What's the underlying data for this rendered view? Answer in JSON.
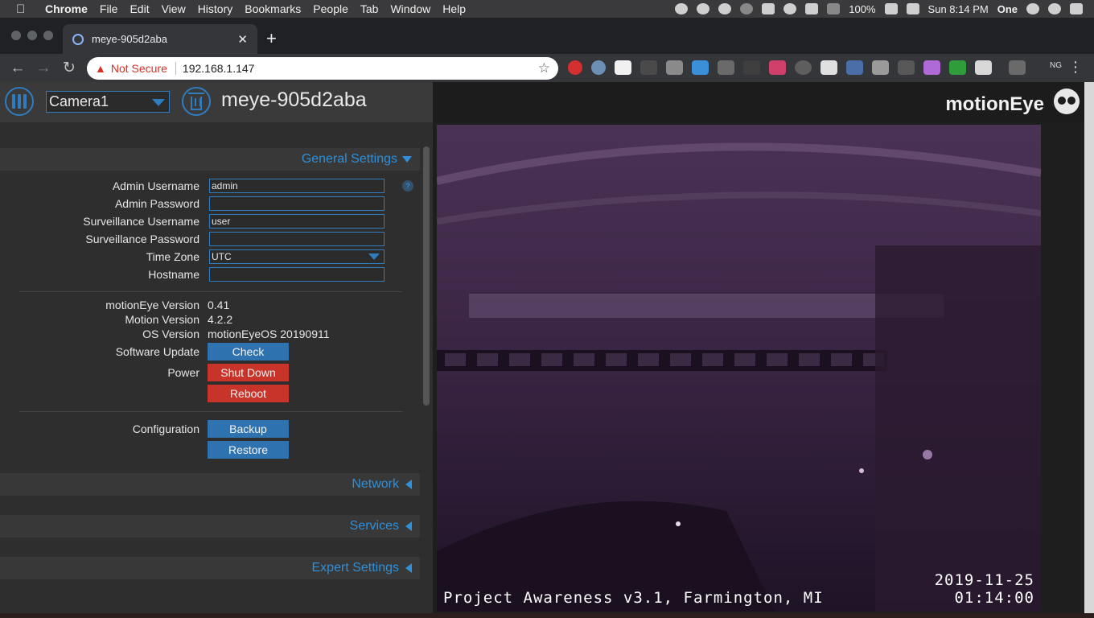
{
  "menubar": {
    "app": "Chrome",
    "items": [
      "File",
      "Edit",
      "View",
      "History",
      "Bookmarks",
      "People",
      "Tab",
      "Window",
      "Help"
    ],
    "battery": "100%",
    "clock": "Sun 8:14 PM",
    "user": "One"
  },
  "browser": {
    "tab_title": "meye-905d2aba",
    "security_label": "Not Secure",
    "url": "192.168.1.147",
    "profile": "NG"
  },
  "app": {
    "camera_selected": "Camera1",
    "device_name": "meye-905d2aba",
    "brand": "motionEye"
  },
  "general": {
    "title": "General Settings",
    "admin_username_label": "Admin Username",
    "admin_username_value": "admin",
    "admin_password_label": "Admin Password",
    "admin_password_value": "",
    "surveillance_username_label": "Surveillance Username",
    "surveillance_username_value": "user",
    "surveillance_password_label": "Surveillance Password",
    "surveillance_password_value": "",
    "timezone_label": "Time Zone",
    "timezone_value": "UTC",
    "hostname_label": "Hostname",
    "hostname_value": "",
    "help": "?",
    "motioneye_version_label": "motionEye Version",
    "motioneye_version_value": "0.41",
    "motion_version_label": "Motion Version",
    "motion_version_value": "4.2.2",
    "os_version_label": "OS Version",
    "os_version_value": "motionEyeOS 20190911",
    "software_update_label": "Software Update",
    "check_button": "Check",
    "power_label": "Power",
    "shutdown_button": "Shut Down",
    "reboot_button": "Reboot",
    "configuration_label": "Configuration",
    "backup_button": "Backup",
    "restore_button": "Restore"
  },
  "sections": {
    "network": "Network",
    "services": "Services",
    "expert": "Expert Settings"
  },
  "camera_feed": {
    "overlay_text": "Project Awareness v3.1, Farmington, MI",
    "date": "2019-11-25",
    "time": "01:14:00"
  },
  "colors": {
    "accent": "#2f8fd8",
    "danger": "#c9342a",
    "button_blue": "#2f72b0"
  }
}
